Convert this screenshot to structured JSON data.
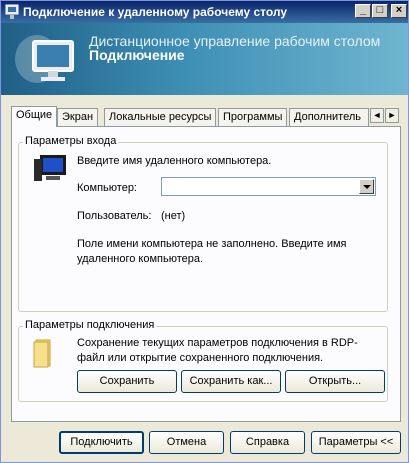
{
  "window": {
    "title": "Подключение к удаленному рабочему столу",
    "controls": {
      "minimize": "_",
      "maximize": "□",
      "close": "×"
    }
  },
  "banner": {
    "line1": "Дистанционное управление рабочим столом",
    "line2": "Подключение"
  },
  "tabs": [
    {
      "label": "Общие",
      "active": true
    },
    {
      "label": "Экран",
      "active": false
    },
    {
      "label": "Локальные ресурсы",
      "active": false
    },
    {
      "label": "Программы",
      "active": false
    },
    {
      "label": "Дополнитель",
      "active": false
    }
  ],
  "tab_scroll": {
    "left": "◄",
    "right": "►"
  },
  "logon": {
    "group_title": "Параметры входа",
    "prompt": "Введите имя удаленного компьютера.",
    "computer_label": "Компьютер:",
    "computer_value": "",
    "user_label": "Пользователь:",
    "user_value": "(нет)",
    "warning": "Поле имени компьютера не заполнено. Введите имя удаленного компьютера."
  },
  "connection": {
    "group_title": "Параметры подключения",
    "description": "Сохранение текущих параметров подключения в RDP-файл или открытие сохраненного подключения.",
    "save": "Сохранить",
    "save_as": "Сохранить как...",
    "open": "Открыть..."
  },
  "footer": {
    "connect": "Подключить",
    "cancel": "Отмена",
    "help": "Справка",
    "options": "Параметры <<"
  }
}
